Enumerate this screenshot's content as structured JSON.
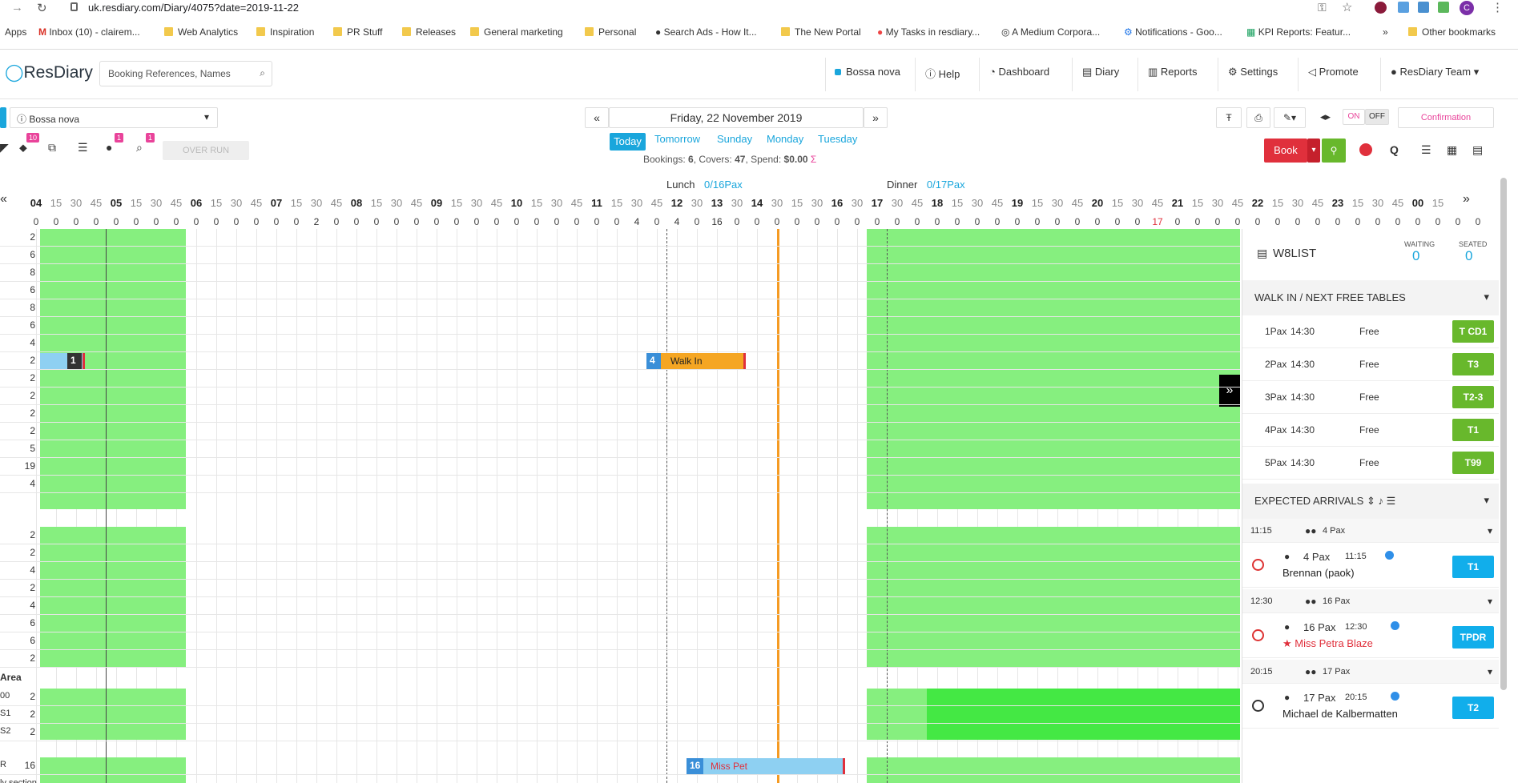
{
  "browser": {
    "url": "uk.resdiary.com/Diary/4075?date=2019-11-22",
    "bookmarks": [
      "Apps",
      "Inbox (10) - clairem...",
      "Web Analytics",
      "Inspiration",
      "PR Stuff",
      "Releases",
      "General marketing",
      "Personal",
      "Search Ads - How It...",
      "The New Portal",
      "My Tasks in resdiary...",
      "A Medium Corpora...",
      "Notifications - Goo...",
      "KPI Reports: Featur...",
      "»",
      "Other bookmarks"
    ]
  },
  "app": {
    "logo": "ResDiary",
    "search_placeholder": "Booking References, Names",
    "nav": [
      "Bossa nova",
      "Help",
      "Dashboard",
      "Diary",
      "Reports",
      "Settings",
      "Promote",
      "ResDiary Team"
    ]
  },
  "toolbar": {
    "venue": "Bossa nova",
    "date": "Friday, 22 November 2019",
    "badges": [
      "10",
      "1",
      "1"
    ],
    "overrun": "OVER RUN",
    "days": [
      "Today",
      "Tomorrow",
      "Sunday",
      "Monday",
      "Tuesday"
    ],
    "summary_prefix": "Bookings:",
    "bookings": "6",
    "covers_label": "Covers:",
    "covers": "47",
    "spend_label": "Spend:",
    "spend": "$0.00",
    "book": "Book",
    "q": "Q",
    "on": "ON",
    "off": "OFF",
    "confirmation": "Confirmation"
  },
  "services": {
    "lunch": "Lunch",
    "lunch_pax": "0/16Pax",
    "dinner": "Dinner",
    "dinner_pax": "0/17Pax"
  },
  "time_ticks": [
    "04",
    "15",
    "30",
    "45",
    "05",
    "15",
    "30",
    "45",
    "06",
    "15",
    "30",
    "45",
    "07",
    "15",
    "30",
    "45",
    "08",
    "15",
    "30",
    "45",
    "09",
    "15",
    "30",
    "45",
    "10",
    "15",
    "30",
    "45",
    "11",
    "15",
    "30",
    "45",
    "12",
    "30",
    "13",
    "30",
    "14",
    "30",
    "15",
    "30",
    "16",
    "30",
    "17",
    "30",
    "45",
    "18",
    "15",
    "30",
    "45",
    "19",
    "15",
    "30",
    "45",
    "20",
    "15",
    "30",
    "45",
    "21",
    "15",
    "30",
    "45",
    "22",
    "15",
    "30",
    "45",
    "23",
    "15",
    "30",
    "45",
    "00",
    "15"
  ],
  "counts": [
    "0",
    "0",
    "0",
    "0",
    "0",
    "0",
    "0",
    "0",
    "0",
    "0",
    "0",
    "0",
    "0",
    "0",
    "2",
    "0",
    "0",
    "0",
    "0",
    "0",
    "0",
    "0",
    "0",
    "0",
    "0",
    "0",
    "0",
    "0",
    "0",
    "0",
    "4",
    "0",
    "4",
    "0",
    "16",
    "0",
    "0",
    "0",
    "0",
    "0",
    "0",
    "0",
    "0",
    "0",
    "0",
    "0",
    "0",
    "0",
    "0",
    "0",
    "0",
    "0",
    "0",
    "0",
    "0",
    "0",
    "17",
    "0",
    "0",
    "0",
    "0",
    "0",
    "0",
    "0",
    "0",
    "0",
    "0",
    "0",
    "0",
    "0",
    "0",
    "0",
    "0"
  ],
  "rows": [
    "2",
    "6",
    "8",
    "6",
    "8",
    "6",
    "4",
    "2",
    "2",
    "2",
    "2",
    "2",
    "5",
    "19",
    "4"
  ],
  "rows2": [
    "2",
    "2",
    "4",
    "2",
    "4",
    "6",
    "6",
    "2"
  ],
  "area_label": "Area",
  "rows3": [
    {
      "t": "00",
      "v": "2"
    },
    {
      "t": "S1",
      "v": "2"
    },
    {
      "t": "S2",
      "v": "2"
    }
  ],
  "row_last": {
    "t": "R",
    "v": "16"
  },
  "bookings": [
    {
      "n": "1"
    },
    {
      "n": "4",
      "label": "Walk In"
    },
    {
      "n": "16",
      "label": "Miss Pet"
    }
  ],
  "footer_text": "ly section",
  "sidebar": {
    "title": "W8LIST",
    "waiting_label": "WAITING",
    "waiting": "0",
    "seated_label": "SEATED",
    "seated": "0",
    "walkin_title": "WALK IN / NEXT FREE TABLES",
    "walkin": [
      {
        "pax": "1Pax",
        "time": "14:30",
        "status": "Free",
        "table": "T CD1"
      },
      {
        "pax": "2Pax",
        "time": "14:30",
        "status": "Free",
        "table": "T3"
      },
      {
        "pax": "3Pax",
        "time": "14:30",
        "status": "Free",
        "table": "T2-3"
      },
      {
        "pax": "4Pax",
        "time": "14:30",
        "status": "Free",
        "table": "T1"
      },
      {
        "pax": "5Pax",
        "time": "14:30",
        "status": "Free",
        "table": "T99"
      }
    ],
    "arrivals_title": "EXPECTED ARRIVALS",
    "groups": [
      {
        "time": "11:15",
        "pax": "4 Pax",
        "bpax": "4 Pax",
        "btime": "11:15",
        "name": "Brennan (paok)",
        "table": "T1"
      },
      {
        "time": "12:30",
        "pax": "16 Pax",
        "bpax": "16 Pax",
        "btime": "12:30",
        "name": "Miss Petra Blaze",
        "table": "TPDR"
      },
      {
        "time": "20:15",
        "pax": "17 Pax",
        "bpax": "17 Pax",
        "btime": "20:15",
        "name": "Michael de Kalbermatten",
        "table": "T2"
      }
    ]
  },
  "colors": {
    "accent": "#1aa6dc",
    "grid_green": "#86ef7f",
    "book": "#e0303c",
    "walkin": "#f5a623",
    "now_line": "#f59b23"
  }
}
